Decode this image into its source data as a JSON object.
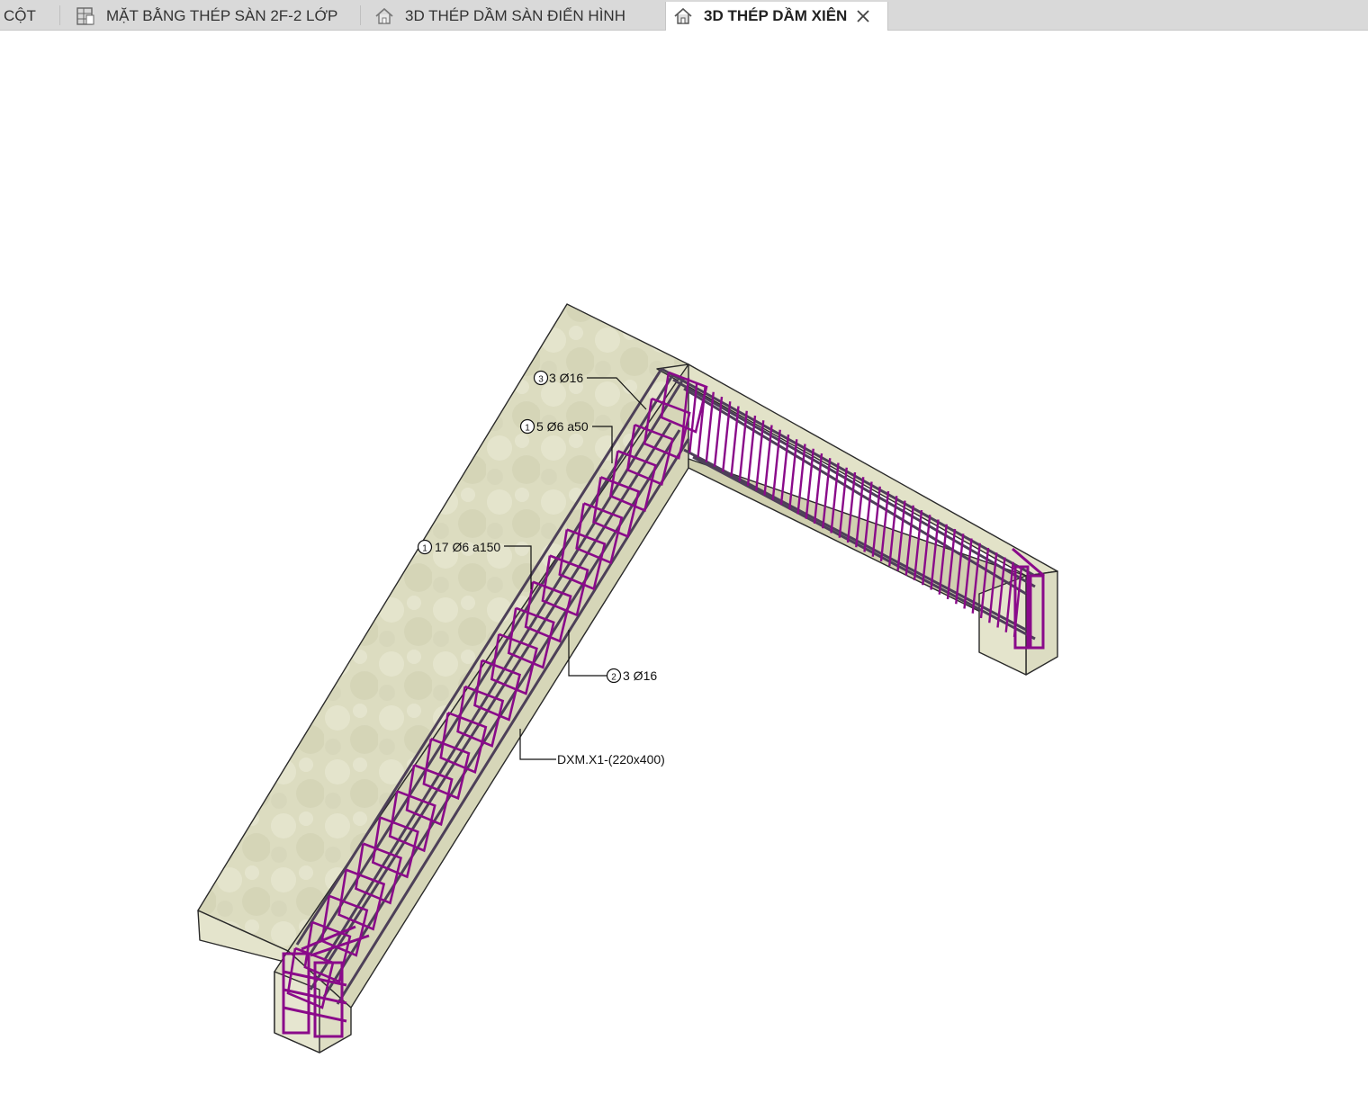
{
  "tabs": [
    {
      "label": "CỘT",
      "icon": "none"
    },
    {
      "label": "MẶT BẰNG THÉP SÀN 2F-2 LỚP",
      "icon": "floor-plan-icon"
    },
    {
      "label": "3D THÉP DẦM SÀN ĐIỂN HÌNH",
      "icon": "house-3d-icon"
    },
    {
      "label": "3D THÉP DẦM XIÊN",
      "icon": "house-3d-icon",
      "active": true
    }
  ],
  "tags": {
    "top_bar": {
      "num": "3",
      "text": "3 Ø16"
    },
    "stirrup_dense": {
      "num": "1",
      "text": "5 Ø6 a50"
    },
    "stirrup_normal": {
      "num": "1",
      "text": "17 Ø6 a150"
    },
    "bottom_bar": {
      "num": "2",
      "text": "3 Ø16"
    },
    "beam_name": {
      "text": "DXM.X1-(220x400)"
    }
  },
  "colors": {
    "concrete": "#dcdcc0",
    "rebar": "#8a0a8a",
    "bar": "#5a4a66",
    "tabbar": "#d9d9d9"
  }
}
